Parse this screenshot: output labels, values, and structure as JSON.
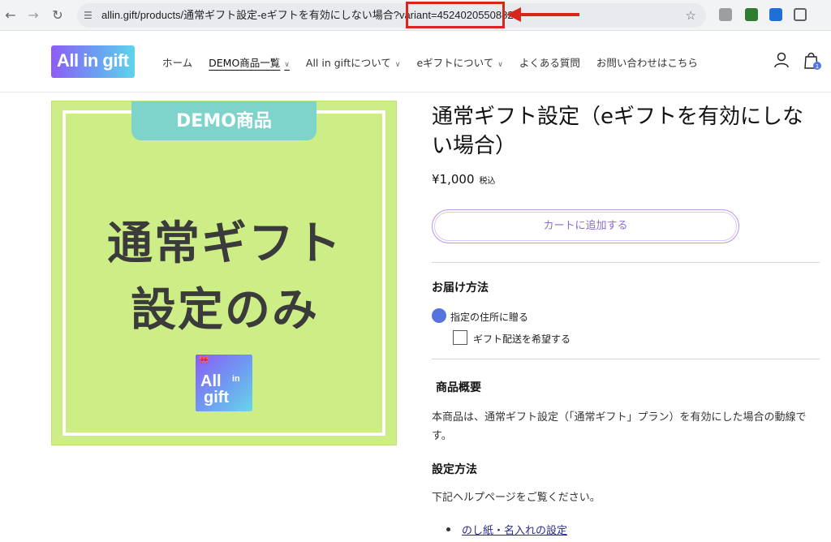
{
  "browser": {
    "url_host": "allin.gift",
    "url_path_before": "/products/通常ギフト設定-eギフトを有効にしない場合?variant=",
    "url_variant": "45240205508828"
  },
  "header": {
    "logo": "All in gift",
    "nav": [
      {
        "label": "ホーム",
        "dropdown": false,
        "active": false
      },
      {
        "label": "DEMO商品一覧",
        "dropdown": true,
        "active": true
      },
      {
        "label": "All in giftについて",
        "dropdown": true,
        "active": false
      },
      {
        "label": "eギフトについて",
        "dropdown": true,
        "active": false
      },
      {
        "label": "よくある質問",
        "dropdown": false,
        "active": false
      },
      {
        "label": "お問い合わせはこちら",
        "dropdown": false,
        "active": false
      }
    ],
    "cart_count": "1"
  },
  "image": {
    "badge": "DEMO商品",
    "line1": "通常ギフト",
    "line2": "設定のみ"
  },
  "product": {
    "title": "通常ギフト設定（eギフトを有効にしない場合）",
    "price": "¥1,000",
    "tax_label": "税込",
    "add_to_cart": "カートに追加する"
  },
  "delivery": {
    "heading": "お届け方法",
    "option_address": "指定の住所に贈る",
    "option_gift_shipping": "ギフト配送を希望する"
  },
  "overview": {
    "heading": "商品概要",
    "text": "本商品は、通常ギフト設定（「通常ギフト」プラン）を有効にした場合の動線です。"
  },
  "setup": {
    "heading": "設定方法",
    "text": "下記ヘルプページをご覧ください。",
    "link": "のし紙・名入れの設定"
  },
  "colors": {
    "highlight": "#d8261c",
    "image_bg": "#cdee86",
    "badge_bg": "#7ed3cb",
    "radio": "#5574de",
    "button_border": "#b996e6"
  }
}
